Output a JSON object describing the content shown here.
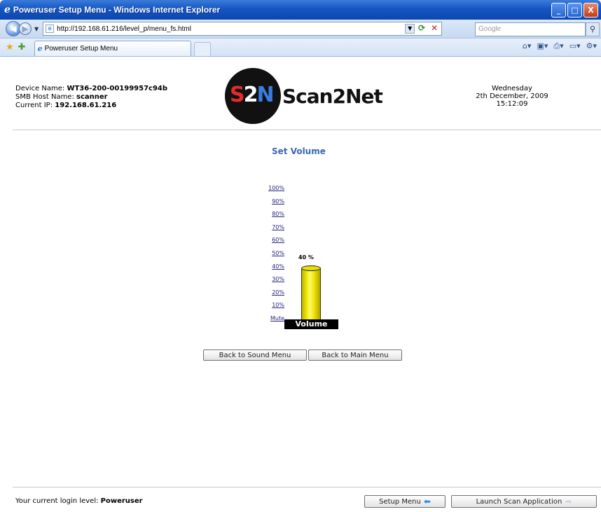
{
  "window": {
    "title": "Poweruser Setup Menu - Windows Internet Explorer",
    "controls": [
      "_",
      "□",
      "X"
    ]
  },
  "navbar": {
    "url": "http://192.168.61.216/level_p/menu_fs.html",
    "search_placeholder": "Google"
  },
  "tabs": [
    {
      "label": "Poweruser Setup Menu"
    }
  ],
  "header": {
    "device_name_label": "Device Name:",
    "device_name": "WT36-200-00199957c94b",
    "smb_label": "SMB Host Name:",
    "smb_host": "scanner",
    "ip_label": "Current IP:",
    "ip": "192.168.61.216",
    "logo_mark": "S2N",
    "logo_text": "Scan2Net",
    "day": "Wednesday",
    "date": "2th December, 2009",
    "time": "15:12:09"
  },
  "main": {
    "heading": "Set Volume",
    "levels": [
      "100%",
      "90%",
      "80%",
      "70%",
      "60%",
      "50%",
      "40%",
      "30%",
      "20%",
      "10%",
      "Mute"
    ],
    "volume_value": 40,
    "volume_text": "40 %",
    "volume_label": "Volume",
    "buttons": {
      "back_sound": "Back to Sound Menu",
      "back_main": "Back to Main Menu"
    }
  },
  "footer": {
    "login_text": "Your current login level:",
    "login_level": "Poweruser",
    "setup_menu": "Setup Menu",
    "launch_scan": "Launch Scan Application"
  },
  "colors": {
    "titlebar": "#1556c4",
    "heading": "#3a66b5",
    "bar_fill": "#f8ee10",
    "link": "#24247e"
  }
}
